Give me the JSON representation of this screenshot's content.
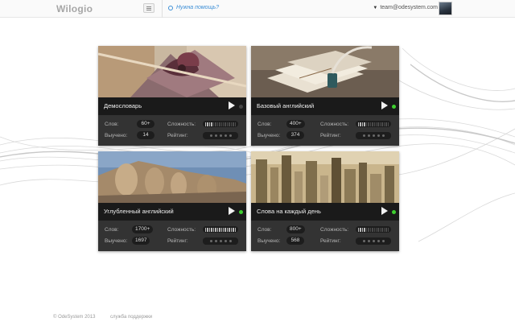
{
  "header": {
    "logo": "Wilogio",
    "help_text": "Нужна помощь?",
    "user_email": "team@odesystem.com"
  },
  "labels": {
    "words": "Слов:",
    "learned": "Выучено:",
    "difficulty": "Сложность:",
    "rating": "Рейтинг:"
  },
  "colors": {
    "accent_blue": "#3d8fd6",
    "active_green": "#3ecf2f",
    "card_dark": "#2b2b2b"
  },
  "cards": [
    {
      "title": "Демословарь",
      "words": "60+",
      "learned": "14",
      "difficulty": 0.25,
      "rating": 0,
      "active": false,
      "image": "gift-boxes-with-ribbons"
    },
    {
      "title": "Базовый английский",
      "words": "400+",
      "learned": "374",
      "difficulty": 0.25,
      "rating": 0,
      "active": true,
      "image": "letters-and-quill"
    },
    {
      "title": "Углубленный английский",
      "words": "1700+",
      "learned": "1697",
      "difficulty": 1.0,
      "rating": 0,
      "active": true,
      "image": "mount-rushmore"
    },
    {
      "title": "Слова на каждый день",
      "words": "800+",
      "learned": "568",
      "difficulty": 0.25,
      "rating": 0,
      "active": true,
      "image": "city-skyline"
    }
  ],
  "footer": {
    "copyright": "© OdeSystem 2013",
    "support": "служба поддержки"
  }
}
